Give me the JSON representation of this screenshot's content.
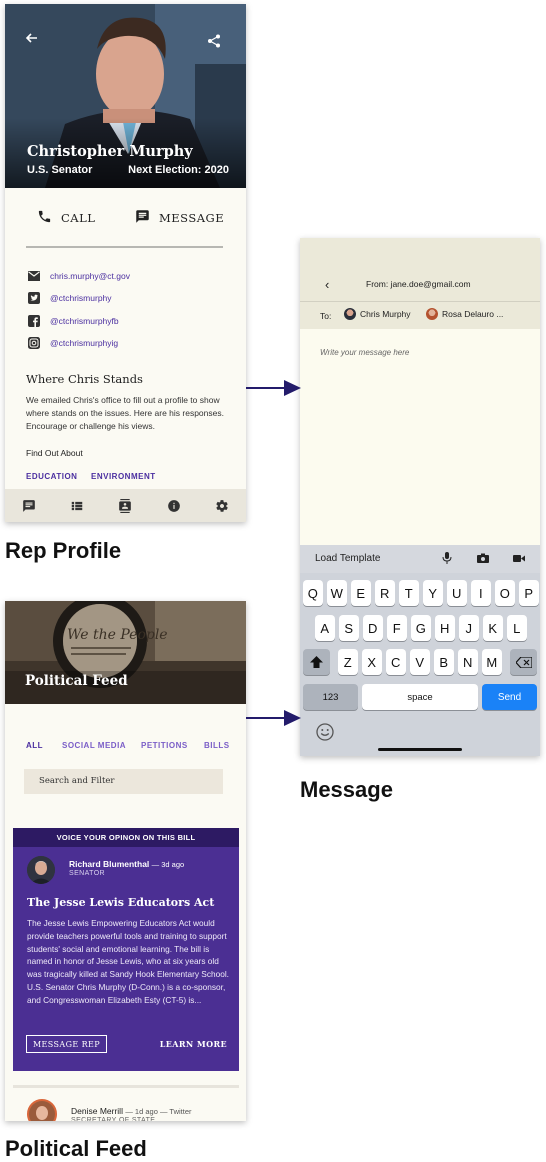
{
  "colors": {
    "accent_purple": "#4b2fa0",
    "bill_card": "#4b2f93",
    "send_blue": "#1a82f7",
    "card_bg": "#fbfaf3"
  },
  "rep_profile": {
    "name": "Christopher Murphy",
    "title": "U.S. Senator",
    "next_election": "Next Election: 2020",
    "call_label": "CALL",
    "message_label": "MESSAGE",
    "contacts": [
      {
        "icon": "email-icon",
        "text": "chris.murphy@ct.gov"
      },
      {
        "icon": "twitter-icon",
        "text": "@ctchrismurphy"
      },
      {
        "icon": "facebook-icon",
        "text": "@ctchrismurphyfb"
      },
      {
        "icon": "instagram-icon",
        "text": "@ctchrismurphyig"
      }
    ],
    "stands_title": "Where Chris Stands",
    "stands_body": "We emailed Chris's office to fill out a profile to show where stands on the issues. Here are his responses. Encourage or challenge his views.",
    "find_out": "Find Out About",
    "topics": [
      "EDUCATION",
      "ENVIRONMENT"
    ],
    "nav_icons": [
      "chat-icon",
      "list-icon",
      "contacts-icon",
      "info-icon",
      "settings-icon"
    ]
  },
  "message": {
    "from": "From: jane.doe@gmail.com",
    "to_label": "To:",
    "recipients": [
      "Chris Murphy",
      "Rosa Delauro ..."
    ],
    "placeholder": "Write your message here",
    "load_template": "Load Template",
    "keyboard": {
      "row1": [
        "Q",
        "W",
        "E",
        "R",
        "T",
        "Y",
        "U",
        "I",
        "O",
        "P"
      ],
      "row2": [
        "A",
        "S",
        "D",
        "F",
        "G",
        "H",
        "J",
        "K",
        "L"
      ],
      "row3": [
        "Z",
        "X",
        "C",
        "V",
        "B",
        "N",
        "M"
      ],
      "numbers": "123",
      "space": "space",
      "send": "Send"
    }
  },
  "feed": {
    "title": "Political Feed",
    "tabs": [
      "ALL",
      "SOCIAL MEDIA",
      "PETITIONS",
      "BILLS"
    ],
    "search_placeholder": "Search and Filter",
    "bill_card": {
      "header": "VOICE YOUR OPINON ON THIS BILL",
      "author": "Richard Blumenthal",
      "ago": "— 3d ago",
      "role": "SENATOR",
      "title": "The Jesse Lewis Educators Act",
      "body": "The Jesse Lewis Empowering Educators Act would provide teachers powerful tools and training to support students' social and emotional learning. The bill is named in honor of Jesse Lewis, who at six years old was tragically killed at Sandy Hook Elementary School. U.S. Senator Chris Murphy (D-Conn.) is a co-sponsor, and Congresswoman Elizabeth Esty (CT-5) is...",
      "message_rep": "MESSAGE REP",
      "learn_more": "LEARN MORE"
    },
    "next_post": {
      "author": "Denise Merrill",
      "ago": "— 1d ago — Twitter",
      "role": "SECRETARY OF STATE"
    }
  },
  "captions": {
    "rep_profile": "Rep Profile",
    "message": "Message",
    "political_feed": "Political Feed"
  }
}
